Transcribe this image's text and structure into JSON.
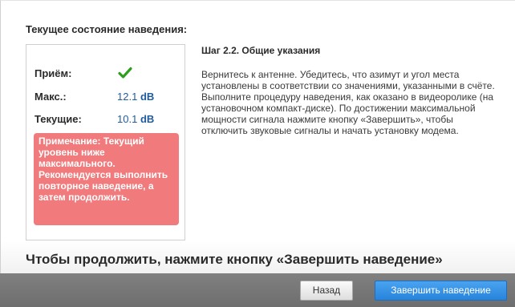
{
  "header": {
    "title": "Текущее состояние наведения:"
  },
  "status": {
    "rows": [
      {
        "label": "Приём:",
        "icon": "check-icon",
        "value": ""
      },
      {
        "label": "Макс.:",
        "value_num": "12.1",
        "value_unit": "dB"
      },
      {
        "label": "Текущие:",
        "value_num": "10.1",
        "value_unit": "dB"
      }
    ],
    "note": "Примечание: Текущий уровень ниже максимального. Рекомендуется выполнить повторное наведение, а затем продолжить."
  },
  "step": {
    "title": "Шаг 2.2. Общие указания",
    "body": "Вернитесь к антенне. Убедитесь, что азимут и угол места установлены в соответствии со значениями, указанными в счёте. Выполните процедуру наведения, как оказано в видеоролике (на установочном компакт-диске). По достижении максимальной мощности сигнала нажмите кнопку «Завершить», чтобы отключить звуковые сигналы и начать установку модема."
  },
  "footer": {
    "instruction": "Чтобы продолжить, нажмите кнопку «Завершить наведение»",
    "back_label": "Назад",
    "finish_label": "Завершить наведение"
  },
  "colors": {
    "check": "#2e9e1e",
    "note_bg": "#f07a7c",
    "value_text": "#1f5c9e",
    "primary_button": "#2784db",
    "footer_bar": "#777777"
  }
}
